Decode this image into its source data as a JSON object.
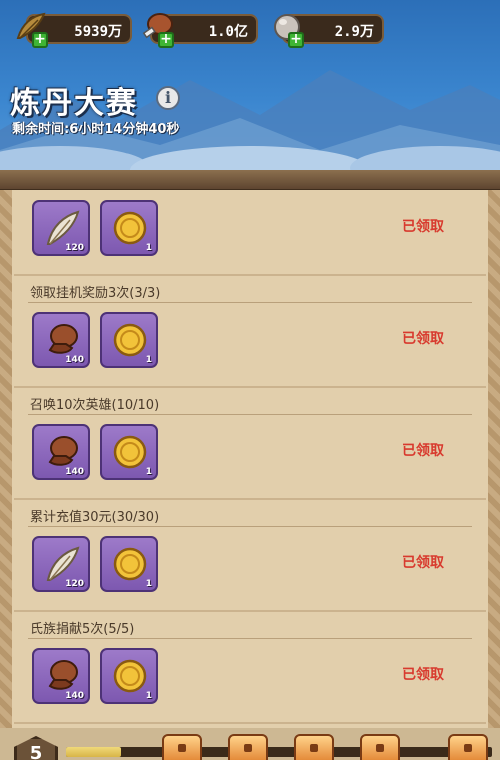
{
  "resources": [
    {
      "icon": "feather-icon",
      "value": "5939万"
    },
    {
      "icon": "meat-icon",
      "value": "1.0亿"
    },
    {
      "icon": "stone-icon",
      "value": "2.9万"
    }
  ],
  "header": {
    "title": "炼丹大赛",
    "timer": "剩余时间:6小时14分钟40秒"
  },
  "tasks": [
    {
      "label": "",
      "rewards": [
        {
          "icon": "feather-icon",
          "qty": "120"
        },
        {
          "icon": "gold-coin-icon",
          "qty": "1"
        }
      ],
      "status": "已领取"
    },
    {
      "label": "领取挂机奖励3次(3/3)",
      "rewards": [
        {
          "icon": "meat-icon",
          "qty": "140"
        },
        {
          "icon": "gold-coin-icon",
          "qty": "1"
        }
      ],
      "status": "已领取"
    },
    {
      "label": "召唤10次英雄(10/10)",
      "rewards": [
        {
          "icon": "meat-icon",
          "qty": "140"
        },
        {
          "icon": "gold-coin-icon",
          "qty": "1"
        }
      ],
      "status": "已领取"
    },
    {
      "label": "累计充值30元(30/30)",
      "rewards": [
        {
          "icon": "feather-icon",
          "qty": "120"
        },
        {
          "icon": "gold-coin-icon",
          "qty": "1"
        }
      ],
      "status": "已领取"
    },
    {
      "label": "氏族捐献5次(5/5)",
      "rewards": [
        {
          "icon": "meat-icon",
          "qty": "140"
        },
        {
          "icon": "gold-coin-icon",
          "qty": "1"
        }
      ],
      "status": "已领取"
    }
  ],
  "progress": {
    "level": "5",
    "fill_fraction": 0.13,
    "chests": 5
  },
  "colors": {
    "claimed": "#d83a2e",
    "item_bg": "#8b66bd",
    "sky": "#3b86cf"
  }
}
